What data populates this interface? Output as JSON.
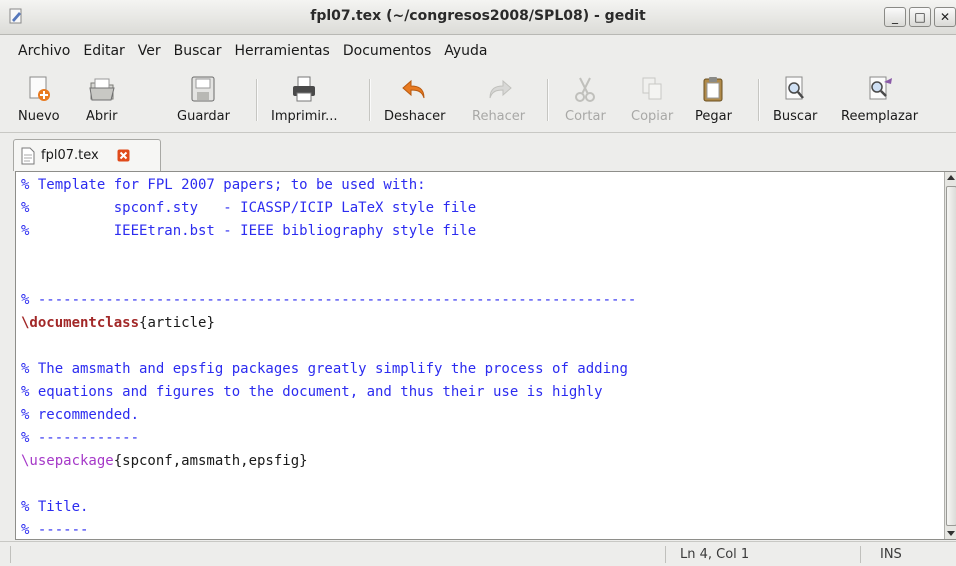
{
  "window": {
    "title": "fpl07.tex (~/congresos2008/SPL08) - gedit",
    "buttons": {
      "minimize": "_",
      "maximize": "□",
      "close": "✕"
    }
  },
  "menubar": {
    "items": [
      "Archivo",
      "Editar",
      "Ver",
      "Buscar",
      "Herramientas",
      "Documentos",
      "Ayuda"
    ]
  },
  "toolbar": {
    "new": "Nuevo",
    "open": "Abrir",
    "save": "Guardar",
    "print": "Imprimir...",
    "undo": "Deshacer",
    "redo": "Rehacer",
    "cut": "Cortar",
    "copy": "Copiar",
    "paste": "Pegar",
    "find": "Buscar",
    "replace": "Reemplazar"
  },
  "tab": {
    "label": "fpl07.tex"
  },
  "editor": {
    "lines": [
      [
        {
          "t": "% Template for FPL 2007 papers; to be used with:",
          "c": "com"
        }
      ],
      [
        {
          "t": "%          spconf.sty   - ICASSP/ICIP LaTeX style file",
          "c": "com"
        }
      ],
      [
        {
          "t": "%          IEEEtran.bst - IEEE bibliography style file",
          "c": "com"
        }
      ],
      [],
      [],
      [
        {
          "t": "% -----------------------------------------------------------------------",
          "c": "com"
        }
      ],
      [
        {
          "t": "\\documentclass",
          "c": "kw"
        },
        {
          "t": "{article}",
          "c": "txt"
        }
      ],
      [],
      [
        {
          "t": "% The amsmath and epsfig packages greatly simplify the process of adding",
          "c": "com"
        }
      ],
      [
        {
          "t": "% equations and figures to the document, and thus their use is highly",
          "c": "com"
        }
      ],
      [
        {
          "t": "% recommended.",
          "c": "com"
        }
      ],
      [
        {
          "t": "% ------------",
          "c": "com"
        }
      ],
      [
        {
          "t": "\\usepackage",
          "c": "pkg"
        },
        {
          "t": "{spconf,amsmath,epsfig}",
          "c": "txt"
        }
      ],
      [],
      [
        {
          "t": "% Title.",
          "c": "com"
        }
      ],
      [
        {
          "t": "% ------",
          "c": "com"
        }
      ]
    ]
  },
  "statusbar": {
    "position": "Ln 4, Col 1",
    "mode": "INS"
  },
  "colors": {
    "comment": "#2c2cf0",
    "keyword": "#a22828",
    "package": "#a538c8",
    "undo_accent": "#e87a20",
    "tab_close": "#e04a1a"
  }
}
